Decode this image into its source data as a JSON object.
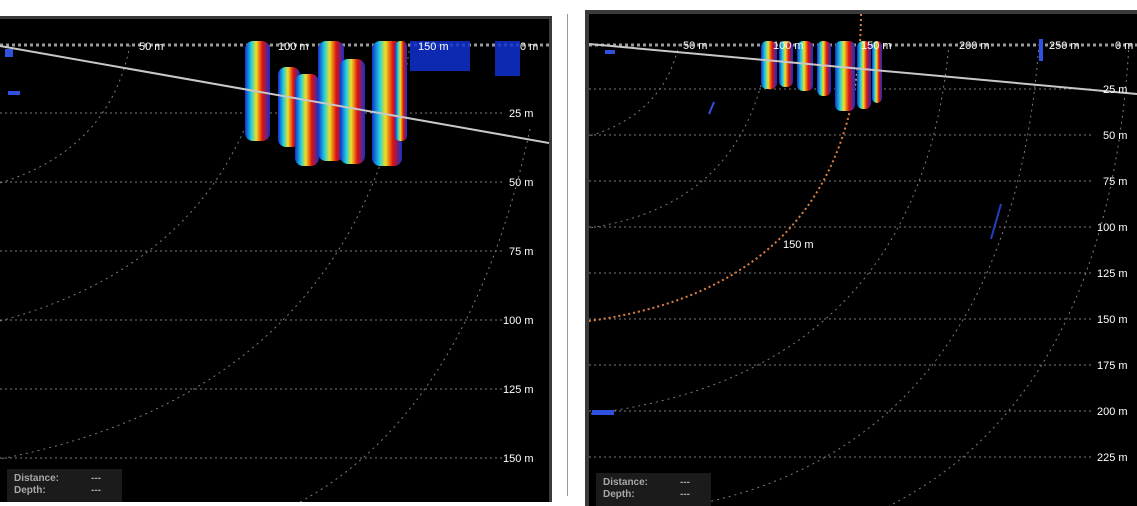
{
  "left_panel": {
    "top_range_labels": [
      "50 m",
      "100 m",
      "150 m",
      "0 m"
    ],
    "depth_labels": [
      "25 m",
      "50 m",
      "75 m",
      "100 m",
      "125 m",
      "150 m"
    ],
    "readout": {
      "distance_label": "Distance:",
      "distance_value": "---",
      "depth_label": "Depth:",
      "depth_value": "---"
    }
  },
  "right_panel": {
    "top_range_labels": [
      "50 m",
      "100 m",
      "150 m",
      "200 m",
      "250 m",
      "0 m"
    ],
    "depth_labels": [
      "25 m",
      "50 m",
      "75 m",
      "100 m",
      "125 m",
      "150 m",
      "175 m",
      "200 m",
      "225 m"
    ],
    "highlighted_ring_label": "150 m",
    "readout": {
      "distance_label": "Distance:",
      "distance_value": "---",
      "depth_label": "Depth:",
      "depth_value": "---"
    }
  },
  "colors": {
    "background": "#000000",
    "grid": "#8a8a8a",
    "highlight_ring": "#e08040",
    "echo_strong": "#e01010",
    "echo_mid": "#f0d020",
    "echo_weak": "#1030d0"
  }
}
